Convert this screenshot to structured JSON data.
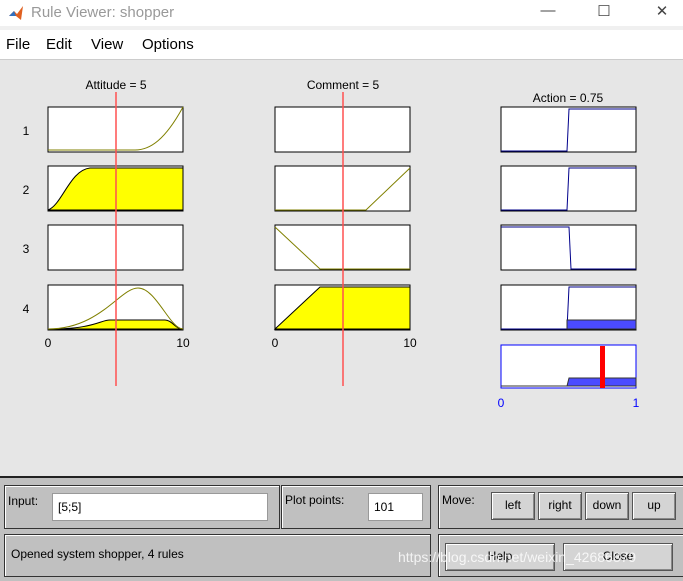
{
  "window": {
    "title": "Rule Viewer: shopper",
    "minimize": "—",
    "maximize": "☐",
    "close": "✕"
  },
  "menu": [
    "File",
    "Edit",
    "View",
    "Options"
  ],
  "inputs": [
    {
      "label": "Attitude = 5",
      "min": "0",
      "max": "10",
      "value": 5
    },
    {
      "label": "Comment = 5",
      "min": "0",
      "max": "10",
      "value": 5
    }
  ],
  "output": {
    "label": "Action = 0.75",
    "min": "0",
    "max": "1",
    "value": 0.75
  },
  "rules": [
    "1",
    "2",
    "3",
    "4"
  ],
  "bottom": {
    "input_label": "Input:",
    "input_value": "[5;5]",
    "plot_points_label": "Plot points:",
    "plot_points_value": "101",
    "move_label": "Move:",
    "left": "left",
    "right": "right",
    "down": "down",
    "up": "up",
    "status": "Opened system shopper, 4 rules",
    "help": "Help",
    "close": "Close"
  },
  "watermark": "https://blog.csdn.net/weixin_42686879",
  "colors": {
    "fill_input": "#ffff00",
    "fill_output": "#4b4bff",
    "indicator": "#ff0000",
    "curve_input": "#808000",
    "curve_output": "#00008b"
  }
}
